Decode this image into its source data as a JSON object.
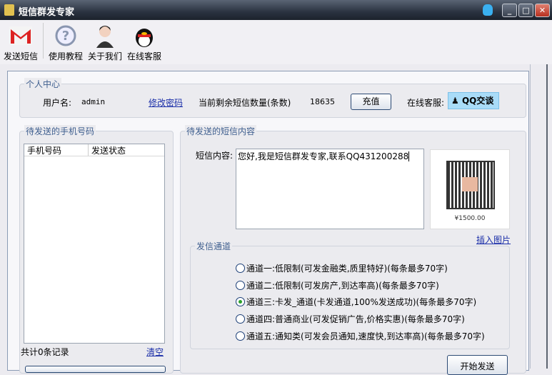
{
  "window": {
    "title": "短信群发专家"
  },
  "toolbar": {
    "items": [
      {
        "label": "发送短信",
        "icon": "gmail-icon"
      },
      {
        "label": "使用教程",
        "icon": "help-icon"
      },
      {
        "label": "关于我们",
        "icon": "agent-icon"
      },
      {
        "label": "在线客服",
        "icon": "qq-penguin-icon"
      }
    ]
  },
  "personal": {
    "title": "个人中心",
    "username_label": "用户名:",
    "username": "admin",
    "change_password": "修改密码",
    "remaining_label": "当前剩余短信数量(条数)",
    "remaining": "18635",
    "recharge": "充值",
    "service_label": "在线客服:",
    "qq_button": "QQ交谈"
  },
  "phones": {
    "title": "待发送的手机号码",
    "columns": [
      "手机号码",
      "发送状态"
    ],
    "rows": [],
    "total": "共计0条记录",
    "clear": "清空"
  },
  "sms": {
    "title": "待发送的短信内容",
    "content_label": "短信内容:",
    "content": "您好,我是短信群发专家,联系QQ431200288",
    "insert_image": "插入图片",
    "qr_price": "¥1500.00"
  },
  "channels": {
    "title": "发信通道",
    "selected": 2,
    "options": [
      "通道一:低限制(可发金融类,质里特好)(每条最多70字)",
      "通道二:低限制(可发房产,到达率高)(每条最多70字)",
      "通道三:卡发_通道(卡发通道,100%发送成功)(每条最多70字)",
      "通道四:普通商业(可发促销广告,价格实惠)(每条最多70字)",
      "通道五:通知类(可发会员通知,速度快,到达率高)(每条最多70字)"
    ]
  },
  "send_button": "开始发送"
}
